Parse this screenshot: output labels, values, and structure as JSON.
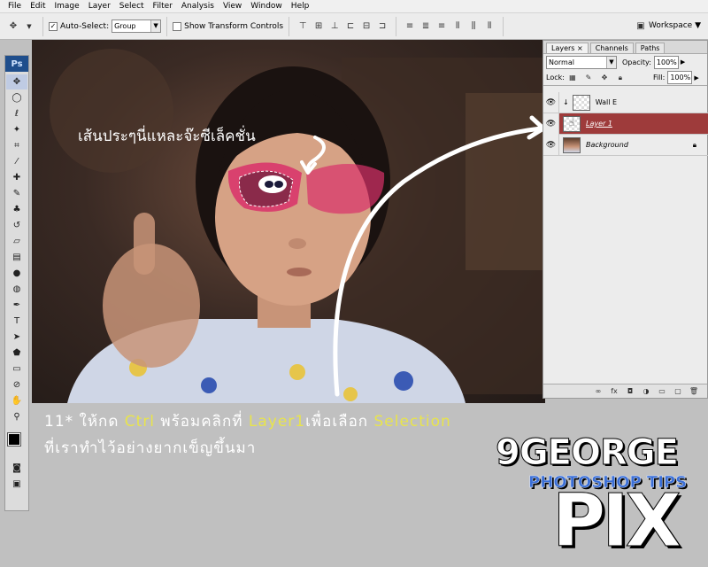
{
  "menu": [
    "File",
    "Edit",
    "Image",
    "Layer",
    "Select",
    "Filter",
    "Analysis",
    "View",
    "Window",
    "Help"
  ],
  "options": {
    "auto_select_label": "Auto-Select:",
    "auto_select_value": "Group",
    "show_transform_label": "Show Transform Controls",
    "workspace_label": "Workspace ▼"
  },
  "toolbox": {
    "logo": "Ps"
  },
  "layers_panel": {
    "tabs": [
      "Layers ×",
      "Channels",
      "Paths"
    ],
    "blend_mode": "Normal",
    "opacity_label": "Opacity:",
    "opacity_value": "100%",
    "lock_label": "Lock:",
    "fill_label": "Fill:",
    "fill_value": "100%",
    "layers": [
      {
        "name": "Wall E"
      },
      {
        "name": "Layer 1"
      },
      {
        "name": "Background"
      }
    ]
  },
  "annotation": {
    "photo_text": "เส้นประๆนี่แหละจ๊ะซีเล็คชั่น",
    "caption_line1_a": "11* ให้กด ",
    "caption_line1_ctrl": "Ctrl",
    "caption_line1_b": " พร้อมคลิกที่ ",
    "caption_line1_layer": "Layer1",
    "caption_line1_c": "เพื่อเลือก ",
    "caption_line1_sel": "Selection",
    "caption_line2": "ที่เราทำไว้อย่างยากเข็ญขึ้นมา"
  },
  "branding": {
    "line1": "9GEORGE",
    "line2": "PHOTOSHOP TIPS",
    "line3": "PIX"
  },
  "colors": {
    "selected_layer": "#9e3b3b",
    "highlight_text": "#e8e44c"
  }
}
